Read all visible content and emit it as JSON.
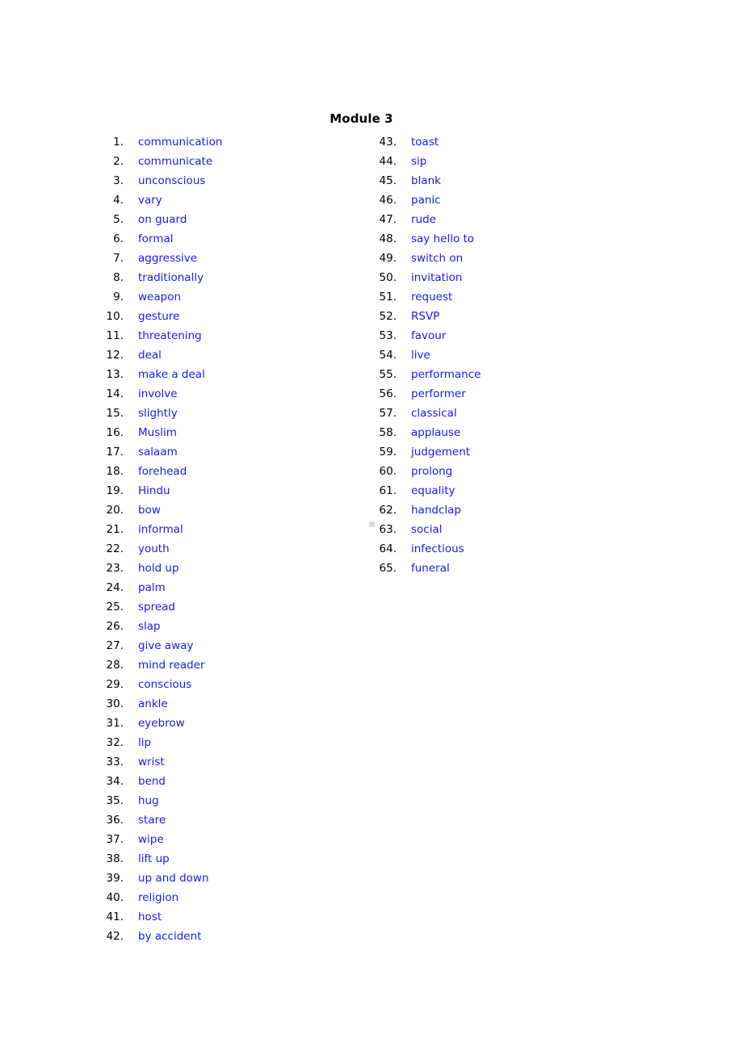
{
  "document": {
    "title": "Module 3",
    "text_color": "#000000",
    "word_color": "#1a19f0",
    "background": "#ffffff",
    "artifact_color": "#dcdcdc"
  },
  "columns": [
    {
      "name": "left-column",
      "items": [
        {
          "number": "1.",
          "word": "communication"
        },
        {
          "number": "2.",
          "word": "communicate"
        },
        {
          "number": "3.",
          "word": "unconscious"
        },
        {
          "number": "4.",
          "word": "vary"
        },
        {
          "number": "5.",
          "word": "on guard"
        },
        {
          "number": "6.",
          "word": "formal"
        },
        {
          "number": "7.",
          "word": "aggressive"
        },
        {
          "number": "8.",
          "word": "traditionally"
        },
        {
          "number": "9.",
          "word": "weapon"
        },
        {
          "number": "10.",
          "word": "gesture"
        },
        {
          "number": "11.",
          "word": "threatening"
        },
        {
          "number": "12.",
          "word": "deal"
        },
        {
          "number": "13.",
          "word": "make a deal"
        },
        {
          "number": "14.",
          "word": "involve"
        },
        {
          "number": "15.",
          "word": "slightly"
        },
        {
          "number": "16.",
          "word": "Muslim"
        },
        {
          "number": "17.",
          "word": "salaam"
        },
        {
          "number": "18.",
          "word": "forehead"
        },
        {
          "number": "19.",
          "word": "Hindu"
        },
        {
          "number": "20.",
          "word": "bow"
        },
        {
          "number": "21.",
          "word": "informal"
        },
        {
          "number": "22.",
          "word": "youth"
        },
        {
          "number": "23.",
          "word": "hold up"
        },
        {
          "number": "24.",
          "word": "palm"
        },
        {
          "number": "25.",
          "word": "spread"
        },
        {
          "number": "26.",
          "word": "slap"
        },
        {
          "number": "27.",
          "word": "give away"
        },
        {
          "number": "28.",
          "word": "mind reader"
        },
        {
          "number": "29.",
          "word": "conscious"
        },
        {
          "number": "30.",
          "word": "ankle"
        },
        {
          "number": "31.",
          "word": "eyebrow"
        },
        {
          "number": "32.",
          "word": "lip"
        },
        {
          "number": "33.",
          "word": "wrist"
        },
        {
          "number": "34.",
          "word": "bend"
        },
        {
          "number": "35.",
          "word": "hug"
        },
        {
          "number": "36.",
          "word": "stare"
        },
        {
          "number": "37.",
          "word": "wipe"
        },
        {
          "number": "38.",
          "word": "lift up"
        },
        {
          "number": "39.",
          "word": "up and down"
        },
        {
          "number": "40.",
          "word": "religion"
        },
        {
          "number": "41.",
          "word": "host"
        },
        {
          "number": "42.",
          "word": "by accident"
        }
      ]
    },
    {
      "name": "right-column",
      "items": [
        {
          "number": "43.",
          "word": "toast"
        },
        {
          "number": "44.",
          "word": "sip"
        },
        {
          "number": "45.",
          "word": "blank"
        },
        {
          "number": "46.",
          "word": "panic"
        },
        {
          "number": "47.",
          "word": "rude"
        },
        {
          "number": "48.",
          "word": "say hello to"
        },
        {
          "number": "49.",
          "word": "switch on"
        },
        {
          "number": "50.",
          "word": "invitation"
        },
        {
          "number": "51.",
          "word": "request"
        },
        {
          "number": "52.",
          "word": "RSVP"
        },
        {
          "number": "53.",
          "word": "favour"
        },
        {
          "number": "54.",
          "word": "live"
        },
        {
          "number": "55.",
          "word": "performance"
        },
        {
          "number": "56.",
          "word": "performer"
        },
        {
          "number": "57.",
          "word": "classical"
        },
        {
          "number": "58.",
          "word": "applause"
        },
        {
          "number": "59.",
          "word": "judgement"
        },
        {
          "number": "60.",
          "word": "prolong"
        },
        {
          "number": "61.",
          "word": "equality"
        },
        {
          "number": "62.",
          "word": "handclap"
        },
        {
          "number": "63.",
          "word": "social"
        },
        {
          "number": "64.",
          "word": "infectious"
        },
        {
          "number": "65.",
          "word": "funeral"
        }
      ]
    }
  ]
}
